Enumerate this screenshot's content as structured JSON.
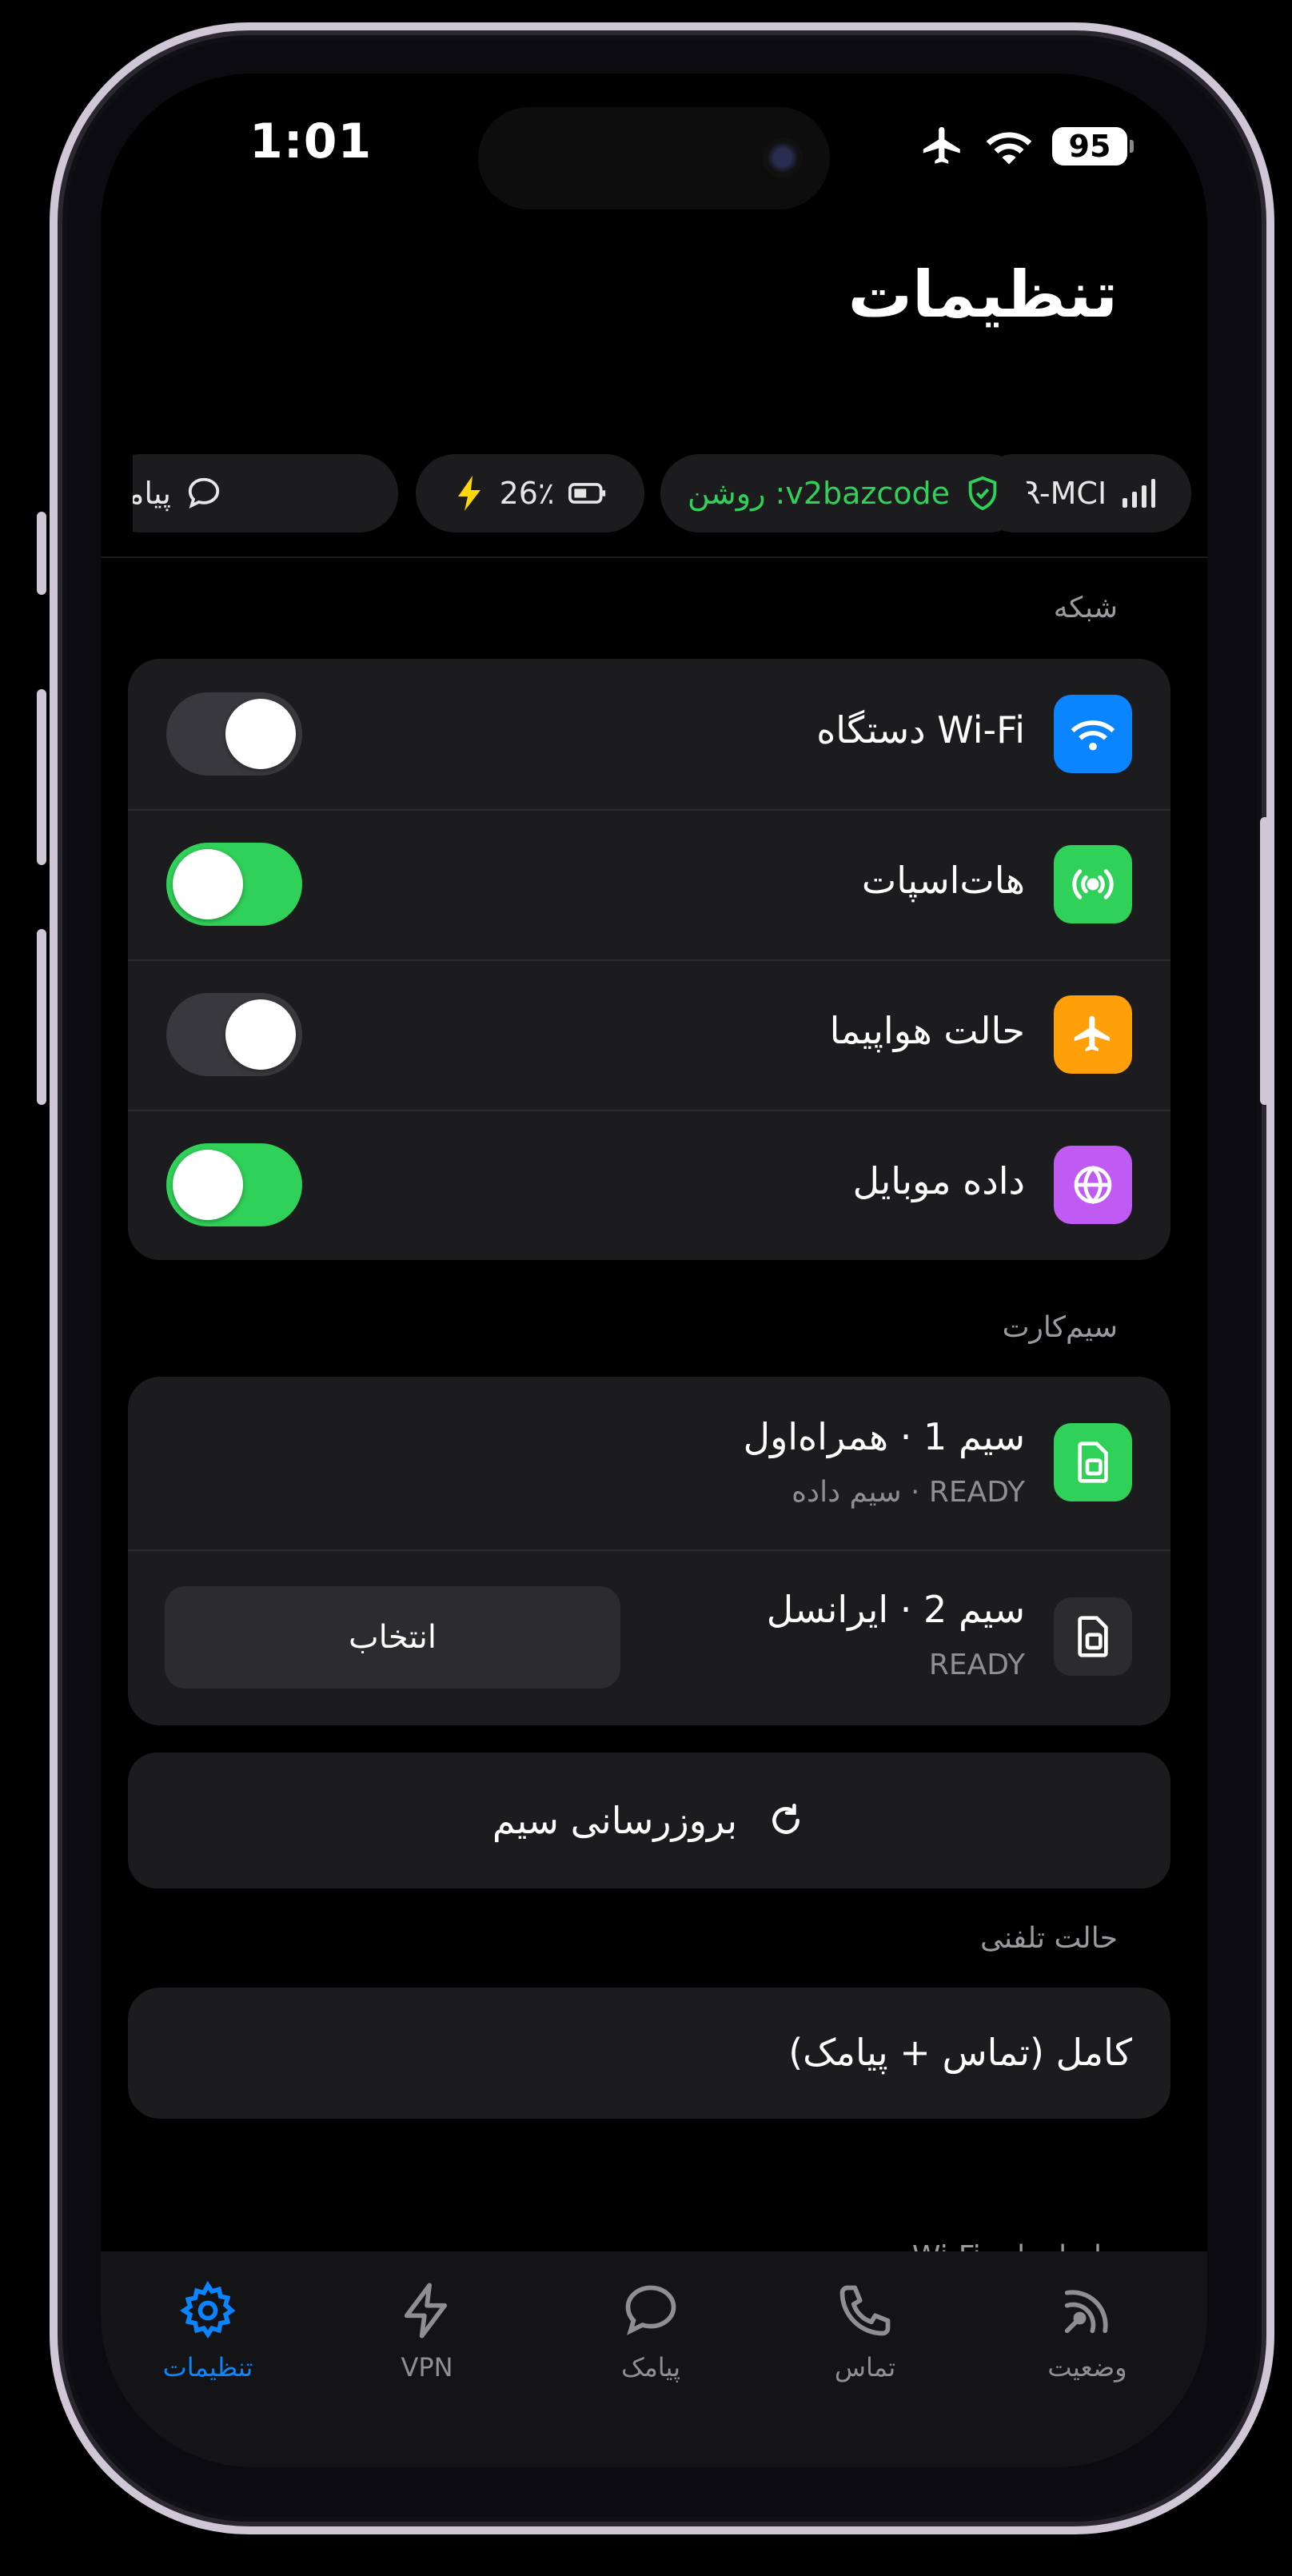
{
  "status_bar": {
    "time": "1:01",
    "battery": "95",
    "icons": [
      "airplane-icon",
      "wifi-icon",
      "battery-icon"
    ]
  },
  "header": {
    "title": "تنظیمات",
    "chips": [
      {
        "icon": "signal-bars-icon",
        "label": "IR-MCI"
      },
      {
        "icon": "shield-check-icon",
        "label": "v2bazcode: روشن",
        "color": "#30d158"
      },
      {
        "icon": "battery-charging-icon",
        "label": "26٪"
      },
      {
        "icon": "message-icon",
        "label": "پیامک"
      }
    ]
  },
  "network": {
    "label": "شبکه",
    "items": [
      {
        "label": "Wi-Fi دستگاه",
        "icon": "wifi-icon",
        "icon_color": "#0a84ff",
        "on": false
      },
      {
        "label": "هات‌اسپات",
        "icon": "hotspot-icon",
        "icon_color": "#30d158",
        "on": true
      },
      {
        "label": "حالت هواپیما",
        "icon": "airplane-icon",
        "icon_color": "#ff9f0a",
        "on": false
      },
      {
        "label": "داده موبایل",
        "icon": "globe-icon",
        "icon_color": "#bf5af2",
        "on": true
      }
    ]
  },
  "sim": {
    "label": "سیم‌کارت",
    "items": [
      {
        "label": "سیم 1 · همراه‌اول",
        "sub": "READY · سیم داده",
        "icon": "sim-card-icon",
        "icon_color": "#30d158"
      },
      {
        "label": "سیم 2 · ایرانسل",
        "sub": "READY",
        "icon": "sim-card-icon",
        "icon_color": "#2c2c2e",
        "action": "انتخاب"
      }
    ],
    "refresh_label": "بروزرسانی سیم"
  },
  "phone_mode": {
    "label": "حالت تلفنی",
    "value": "کامل (تماس + پیامک)"
  },
  "hotspot_section": {
    "label": "هات‌اسپات Wi-Fi"
  },
  "tabs": [
    {
      "label": "تنظیمات",
      "icon": "gear-icon",
      "active": true
    },
    {
      "label": "VPN",
      "icon": "bolt-icon",
      "active": false
    },
    {
      "label": "پیامک",
      "icon": "message-icon",
      "active": false
    },
    {
      "label": "تماس",
      "icon": "phone-icon",
      "active": false
    },
    {
      "label": "وضعیت",
      "icon": "antenna-icon",
      "active": false
    }
  ],
  "colors": {
    "accent": "#0a84ff",
    "toggle_on": "#30d158",
    "card": "#1c1c1e"
  }
}
